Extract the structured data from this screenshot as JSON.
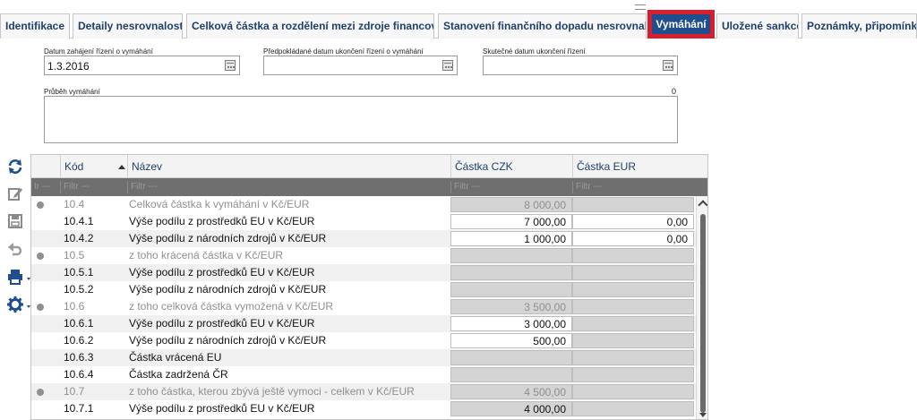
{
  "tabs": [
    {
      "label": "Identifikace",
      "active": false
    },
    {
      "label": "Detaily nesrovnalosti",
      "active": false
    },
    {
      "label": "Celková částka a rozdělení mezi zdroje financování",
      "active": false
    },
    {
      "label": "Stanovení finančního dopadu nesrovnalosti",
      "active": false
    },
    {
      "label": "Vymáhání",
      "active": true
    },
    {
      "label": "Uložené sankce",
      "active": false
    },
    {
      "label": "Poznámky, připomínky",
      "active": false
    }
  ],
  "form": {
    "start_date_label": "Datum zahájení řízení o vymáhání",
    "start_date_value": "1.3.2016",
    "expected_end_label": "Předpokládané datum ukončení řízení o vymáhání",
    "expected_end_value": "",
    "actual_end_label": "Skutečné datum ukončení řízení",
    "actual_end_value": "",
    "progress_label": "Průběh vymáhání",
    "progress_counter": "0",
    "progress_value": ""
  },
  "toolbar": {
    "icons": [
      "refresh-icon",
      "edit-icon",
      "save-icon",
      "undo-icon",
      "print-icon",
      "settings-icon"
    ]
  },
  "grid": {
    "columns": {
      "code": "Kód",
      "name": "Název",
      "czk": "Částka CZK",
      "eur": "Částka EUR"
    },
    "filter": {
      "selector": "Ir ---",
      "code": "Filtr ---",
      "name": "Filtr ---",
      "czk": "Filtr ---",
      "eur": "Filtr ---"
    },
    "rows": [
      {
        "code": "10.4",
        "name": "Celková částka k vymáhání v Kč/EUR",
        "czk": "8 000,00",
        "eur": "",
        "group": true
      },
      {
        "code": "10.4.1",
        "name": "Výše podílu z prostředků EU v Kč/EUR",
        "czk": "7 000,00",
        "eur": "0,00",
        "group": false
      },
      {
        "code": "10.4.2",
        "name": "Výše podílu z národních zdrojů v Kč/EUR",
        "czk": "1 000,00",
        "eur": "0,00",
        "group": false
      },
      {
        "code": "10.5",
        "name": "z toho krácená částka v Kč/EUR",
        "czk": "",
        "eur": "",
        "group": true
      },
      {
        "code": "10.5.1",
        "name": "Výše podílu z prostředků EU v Kč/EUR",
        "czk": "",
        "eur": "",
        "group": false
      },
      {
        "code": "10.5.2",
        "name": "Výše podílu z národních zdrojů v Kč/EUR",
        "czk": "",
        "eur": "",
        "group": false
      },
      {
        "code": "10.6",
        "name": "z toho celková částka vymožená v Kč/EUR",
        "czk": "3 500,00",
        "eur": "",
        "group": true
      },
      {
        "code": "10.6.1",
        "name": "Výše podílu z prostředků EU v Kč/EUR",
        "czk": "3 000,00",
        "eur": "",
        "group": false
      },
      {
        "code": "10.6.2",
        "name": "Výše podílu z národních zdrojů v Kč/EUR",
        "czk": "500,00",
        "eur": "",
        "group": false
      },
      {
        "code": "10.6.3",
        "name": "Částka vrácená EU",
        "czk": "",
        "eur": "",
        "group": false
      },
      {
        "code": "10.6.4",
        "name": "Částka zadržená ČR",
        "czk": "",
        "eur": "",
        "group": false
      },
      {
        "code": "10.7",
        "name": "z toho částka, kterou zbývá ještě vymoci - celkem v Kč/EUR",
        "czk": "4 500,00",
        "eur": "",
        "group": true
      },
      {
        "code": "10.7.1",
        "name": "Výše podílu z prostředků EU v Kč/EUR",
        "czk": "4 000,00",
        "eur": "",
        "group": false
      }
    ]
  }
}
